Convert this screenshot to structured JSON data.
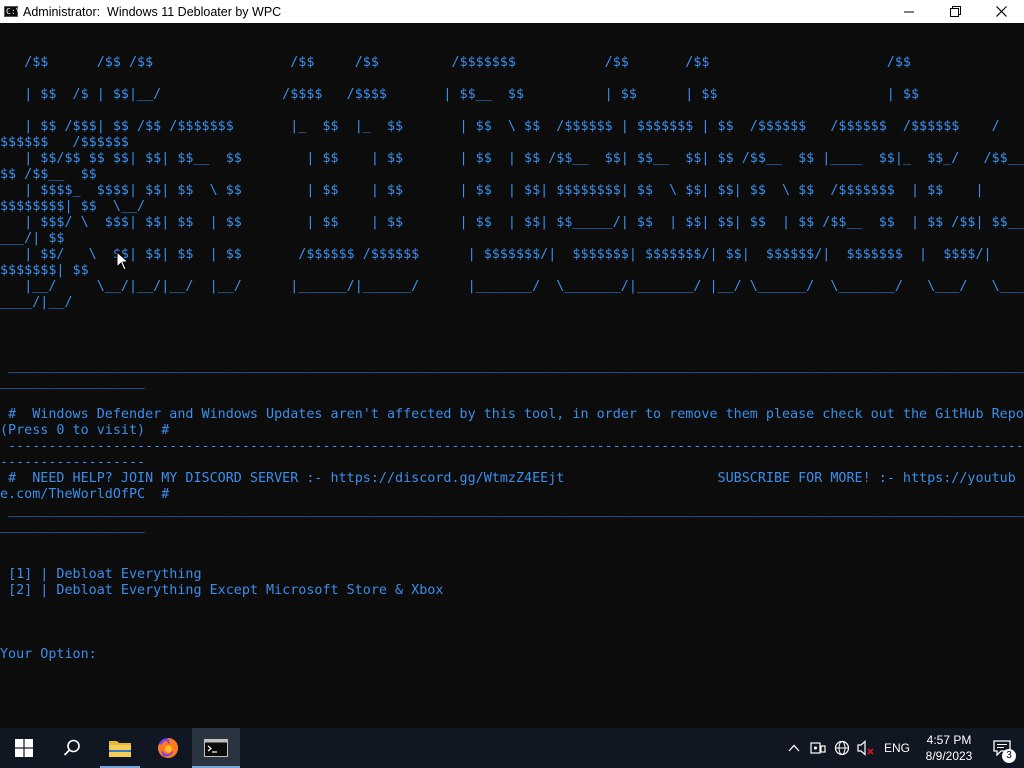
{
  "window": {
    "title": "Administrator:  Windows 11 Debloater by WPC",
    "app_icon_text": "C:\\",
    "minimize_glyph": "—",
    "maximize_glyph": "❐",
    "close_glyph": "✕"
  },
  "console": {
    "text": "\n\n   /$$      /$$ /$$                 /$$     /$$         /$$$$$$$           /$$       /$$                      /$$\n\n   | $$  /$ | $$|__/               /$$$$   /$$$$       | $$__  $$          | $$      | $$                     | $$\n\n   | $$ /$$$| $$ /$$ /$$$$$$$       |_  $$  |_  $$       | $$  \\ $$  /$$$$$$ | $$$$$$$ | $$  /$$$$$$   /$$$$$$  /$$$$$$    /$$$$$$   /$$$$$$\n   | $$/$$ $$ $$| $$| $$__  $$        | $$    | $$       | $$  | $$ /$$__  $$| $$__  $$| $$ /$$__  $$ |____  $$|_  $$_/   /$$__  $$ /$$__  $$\n   | $$$$_  $$$$| $$| $$  \\ $$        | $$    | $$       | $$  | $$| $$$$$$$$| $$  \\ $$| $$| $$  \\ $$  /$$$$$$$  | $$    | $$$$$$$$| $$  \\__/\n   | $$$/ \\  $$$| $$| $$  | $$        | $$    | $$       | $$  | $$| $$_____/| $$  | $$| $$| $$  | $$ /$$__  $$  | $$ /$$| $$_____/| $$\n   | $$/   \\  $$| $$| $$  | $$       /$$$$$$ /$$$$$$      | $$$$$$$/|  $$$$$$$| $$$$$$$/| $$|  $$$$$$/|  $$$$$$$  |  $$$$/|  $$$$$$$| $$\n   |__/     \\__/|__/|__/  |__/      |______/|______/      |_______/  \\_______/|_______/ |__/ \\______/  \\_______/   \\___/   \\_______/|__/\n\n\n\n ________________________________________________________________________________________________________________________________________________\n\n #  Windows Defender and Windows Updates aren't affected by this tool, in order to remove them please check out the GitHub Repo (Press 0 to visit)  #\n ------------------------------------------------------------------------------------------------------------------------------------------------\n #  NEED HELP? JOIN MY DISCORD SERVER :- https://discord.gg/WtmzZ4EEjt                   SUBSCRIBE FOR MORE! :- https://youtube.com/TheWorldOfPC  #\n ________________________________________________________________________________________________________________________________________________\n\n\n [1] | Debloat Everything\n [2] | Debloat Everything Except Microsoft Store & Xbox\n\n\n\nYour Option:"
  },
  "taskbar": {
    "items": [
      {
        "name": "start-button",
        "icon": "windows-logo-icon"
      },
      {
        "name": "search-button",
        "icon": "search-icon"
      },
      {
        "name": "file-explorer",
        "icon": "folder-icon"
      },
      {
        "name": "firefox",
        "icon": "firefox-icon"
      },
      {
        "name": "command-prompt",
        "icon": "terminal-icon"
      }
    ],
    "tray": {
      "language": "ENG",
      "time": "4:57 PM",
      "date": "8/9/2023",
      "notification_count": "3"
    }
  },
  "colors": {
    "console_bg": "#0c0c0c",
    "console_text": "#3b8eea",
    "taskbar_bg": "#101722",
    "titlebar_bg": "#ffffff"
  }
}
